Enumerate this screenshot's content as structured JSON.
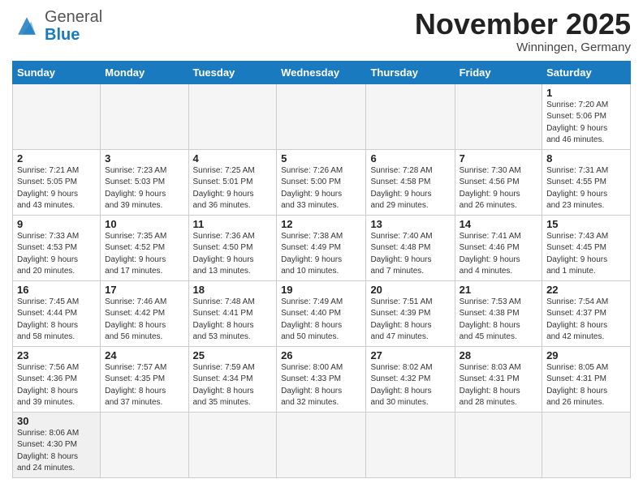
{
  "logo": {
    "general": "General",
    "blue": "Blue"
  },
  "title": "November 2025",
  "location": "Winningen, Germany",
  "days_of_week": [
    "Sunday",
    "Monday",
    "Tuesday",
    "Wednesday",
    "Thursday",
    "Friday",
    "Saturday"
  ],
  "weeks": [
    [
      {
        "day": "",
        "info": ""
      },
      {
        "day": "",
        "info": ""
      },
      {
        "day": "",
        "info": ""
      },
      {
        "day": "",
        "info": ""
      },
      {
        "day": "",
        "info": ""
      },
      {
        "day": "",
        "info": ""
      },
      {
        "day": "1",
        "info": "Sunrise: 7:20 AM\nSunset: 5:06 PM\nDaylight: 9 hours\nand 46 minutes."
      }
    ],
    [
      {
        "day": "2",
        "info": "Sunrise: 7:21 AM\nSunset: 5:05 PM\nDaylight: 9 hours\nand 43 minutes."
      },
      {
        "day": "3",
        "info": "Sunrise: 7:23 AM\nSunset: 5:03 PM\nDaylight: 9 hours\nand 39 minutes."
      },
      {
        "day": "4",
        "info": "Sunrise: 7:25 AM\nSunset: 5:01 PM\nDaylight: 9 hours\nand 36 minutes."
      },
      {
        "day": "5",
        "info": "Sunrise: 7:26 AM\nSunset: 5:00 PM\nDaylight: 9 hours\nand 33 minutes."
      },
      {
        "day": "6",
        "info": "Sunrise: 7:28 AM\nSunset: 4:58 PM\nDaylight: 9 hours\nand 29 minutes."
      },
      {
        "day": "7",
        "info": "Sunrise: 7:30 AM\nSunset: 4:56 PM\nDaylight: 9 hours\nand 26 minutes."
      },
      {
        "day": "8",
        "info": "Sunrise: 7:31 AM\nSunset: 4:55 PM\nDaylight: 9 hours\nand 23 minutes."
      }
    ],
    [
      {
        "day": "9",
        "info": "Sunrise: 7:33 AM\nSunset: 4:53 PM\nDaylight: 9 hours\nand 20 minutes."
      },
      {
        "day": "10",
        "info": "Sunrise: 7:35 AM\nSunset: 4:52 PM\nDaylight: 9 hours\nand 17 minutes."
      },
      {
        "day": "11",
        "info": "Sunrise: 7:36 AM\nSunset: 4:50 PM\nDaylight: 9 hours\nand 13 minutes."
      },
      {
        "day": "12",
        "info": "Sunrise: 7:38 AM\nSunset: 4:49 PM\nDaylight: 9 hours\nand 10 minutes."
      },
      {
        "day": "13",
        "info": "Sunrise: 7:40 AM\nSunset: 4:48 PM\nDaylight: 9 hours\nand 7 minutes."
      },
      {
        "day": "14",
        "info": "Sunrise: 7:41 AM\nSunset: 4:46 PM\nDaylight: 9 hours\nand 4 minutes."
      },
      {
        "day": "15",
        "info": "Sunrise: 7:43 AM\nSunset: 4:45 PM\nDaylight: 9 hours\nand 1 minute."
      }
    ],
    [
      {
        "day": "16",
        "info": "Sunrise: 7:45 AM\nSunset: 4:44 PM\nDaylight: 8 hours\nand 58 minutes."
      },
      {
        "day": "17",
        "info": "Sunrise: 7:46 AM\nSunset: 4:42 PM\nDaylight: 8 hours\nand 56 minutes."
      },
      {
        "day": "18",
        "info": "Sunrise: 7:48 AM\nSunset: 4:41 PM\nDaylight: 8 hours\nand 53 minutes."
      },
      {
        "day": "19",
        "info": "Sunrise: 7:49 AM\nSunset: 4:40 PM\nDaylight: 8 hours\nand 50 minutes."
      },
      {
        "day": "20",
        "info": "Sunrise: 7:51 AM\nSunset: 4:39 PM\nDaylight: 8 hours\nand 47 minutes."
      },
      {
        "day": "21",
        "info": "Sunrise: 7:53 AM\nSunset: 4:38 PM\nDaylight: 8 hours\nand 45 minutes."
      },
      {
        "day": "22",
        "info": "Sunrise: 7:54 AM\nSunset: 4:37 PM\nDaylight: 8 hours\nand 42 minutes."
      }
    ],
    [
      {
        "day": "23",
        "info": "Sunrise: 7:56 AM\nSunset: 4:36 PM\nDaylight: 8 hours\nand 39 minutes."
      },
      {
        "day": "24",
        "info": "Sunrise: 7:57 AM\nSunset: 4:35 PM\nDaylight: 8 hours\nand 37 minutes."
      },
      {
        "day": "25",
        "info": "Sunrise: 7:59 AM\nSunset: 4:34 PM\nDaylight: 8 hours\nand 35 minutes."
      },
      {
        "day": "26",
        "info": "Sunrise: 8:00 AM\nSunset: 4:33 PM\nDaylight: 8 hours\nand 32 minutes."
      },
      {
        "day": "27",
        "info": "Sunrise: 8:02 AM\nSunset: 4:32 PM\nDaylight: 8 hours\nand 30 minutes."
      },
      {
        "day": "28",
        "info": "Sunrise: 8:03 AM\nSunset: 4:31 PM\nDaylight: 8 hours\nand 28 minutes."
      },
      {
        "day": "29",
        "info": "Sunrise: 8:05 AM\nSunset: 4:31 PM\nDaylight: 8 hours\nand 26 minutes."
      }
    ],
    [
      {
        "day": "30",
        "info": "Sunrise: 8:06 AM\nSunset: 4:30 PM\nDaylight: 8 hours\nand 24 minutes."
      },
      {
        "day": "",
        "info": ""
      },
      {
        "day": "",
        "info": ""
      },
      {
        "day": "",
        "info": ""
      },
      {
        "day": "",
        "info": ""
      },
      {
        "day": "",
        "info": ""
      },
      {
        "day": "",
        "info": ""
      }
    ]
  ]
}
